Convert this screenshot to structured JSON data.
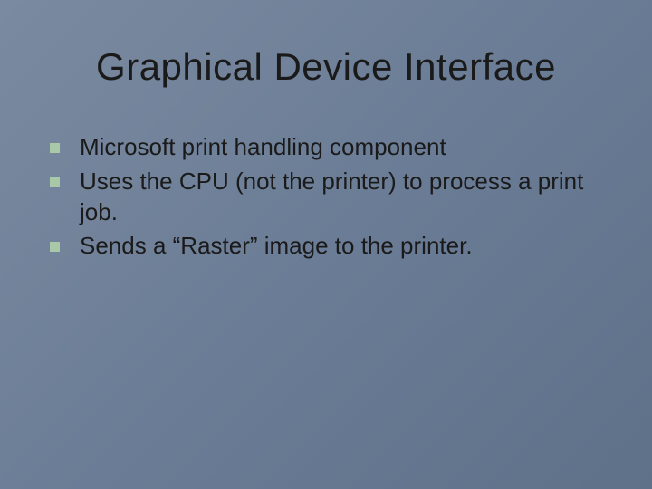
{
  "slide": {
    "title": "Graphical Device Interface",
    "bullets": [
      {
        "text": "Microsoft print handling component"
      },
      {
        "text": "Uses the CPU (not the printer) to process a print job."
      },
      {
        "text": "Sends a “Raster” image to the printer."
      }
    ]
  },
  "colors": {
    "background_start": "#7a8aa0",
    "background_end": "#5f7189",
    "bullet": "#a8c8a8",
    "text": "#1a1a1a"
  }
}
